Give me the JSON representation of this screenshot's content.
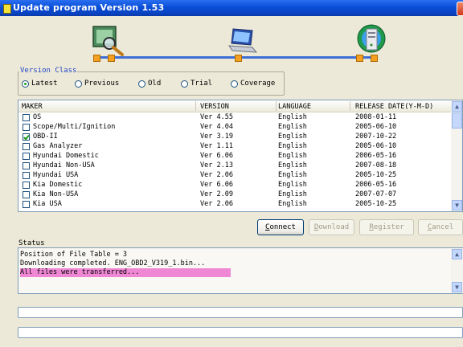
{
  "window": {
    "title": "Update program Version 1.53"
  },
  "toolbar": {
    "icons": [
      "inspect-icon",
      "laptop-icon",
      "server-icon"
    ]
  },
  "version_class": {
    "label": "Version Class",
    "options": [
      "Latest",
      "Previous",
      "Old",
      "Trial",
      "Coverage"
    ],
    "selected": "Latest"
  },
  "list": {
    "columns": [
      "MAKER",
      "VERSION",
      "LANGUAGE",
      "RELEASE DATE(Y-M-D)"
    ],
    "rows": [
      {
        "maker": "OS",
        "version": "Ver 4.55",
        "language": "English",
        "date": "2008-01-11",
        "checked": false
      },
      {
        "maker": "Scope/Multi/Ignition",
        "version": "Ver 4.04",
        "language": "English",
        "date": "2005-06-10",
        "checked": false
      },
      {
        "maker": "OBD-II",
        "version": "Ver 3.19",
        "language": "English",
        "date": "2007-10-22",
        "checked": true
      },
      {
        "maker": "Gas Analyzer",
        "version": "Ver 1.11",
        "language": "English",
        "date": "2005-06-10",
        "checked": false
      },
      {
        "maker": "Hyundai Domestic",
        "version": "Ver 6.06",
        "language": "English",
        "date": "2006-05-16",
        "checked": false
      },
      {
        "maker": "Hyundai Non-USA",
        "version": "Ver 2.13",
        "language": "English",
        "date": "2007-08-18",
        "checked": false
      },
      {
        "maker": "Hyundai USA",
        "version": "Ver 2.06",
        "language": "English",
        "date": "2005-10-25",
        "checked": false
      },
      {
        "maker": "Kia Domestic",
        "version": "Ver 6.06",
        "language": "English",
        "date": "2006-05-16",
        "checked": false
      },
      {
        "maker": "Kia Non-USA",
        "version": "Ver 2.09",
        "language": "English",
        "date": "2007-07-07",
        "checked": false
      },
      {
        "maker": "Kia USA",
        "version": "Ver 2.06",
        "language": "English",
        "date": "2005-10-25",
        "checked": false
      }
    ]
  },
  "buttons": {
    "connect": "Connect",
    "download": "Download",
    "register": "Register",
    "cancel": "Cancel"
  },
  "status": {
    "label": "Status",
    "lines": [
      "Position of File Table = 3",
      "Downloading completed. ENG_OBD2_V319_1.bin...",
      "All files were transferred..."
    ]
  },
  "progress": {
    "bar1": 0,
    "bar2": 0
  },
  "colors": {
    "titlebar": "#0a4fd8",
    "highlight": "#ef87d4",
    "group_label": "#2145c6"
  }
}
